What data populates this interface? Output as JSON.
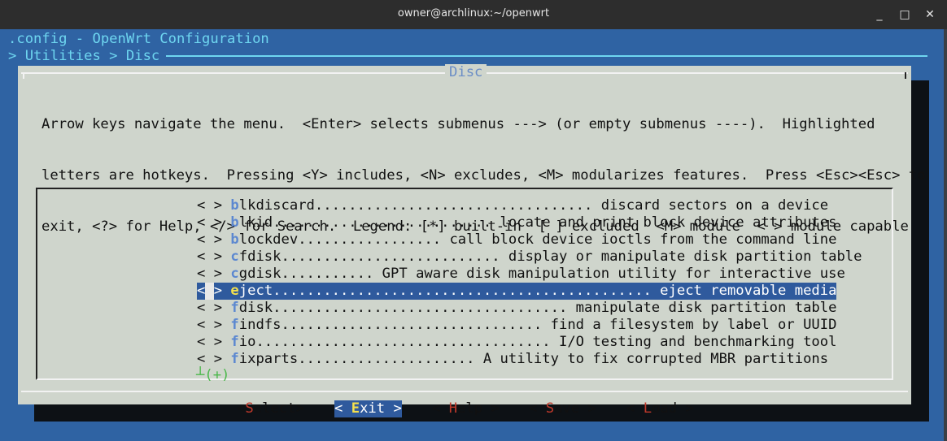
{
  "window": {
    "title": "owner@archlinux:~/openwrt",
    "minimize": "_",
    "maximize": "□",
    "close": "✕"
  },
  "header": {
    "line1": ".config - OpenWrt Configuration",
    "line2": "> Utilities > Disc"
  },
  "dialog": {
    "title": "Disc",
    "help": [
      "Arrow keys navigate the menu.  <Enter> selects submenus ---> (or empty submenus ----).  Highlighted",
      "letters are hotkeys.  Pressing <Y> includes, <N> excludes, <M> modularizes features.  Press <Esc><Esc> to",
      "exit, <?> for Help, </> for Search.  Legend: [*] built-in  [ ] excluded  <M> module  < > module capable"
    ]
  },
  "menu": {
    "items": [
      {
        "prefix": "< > ",
        "hotkey": "b",
        "rest": "lkdiscard................................. discard sectors on a device",
        "selected": false
      },
      {
        "prefix": "< > ",
        "hotkey": "b",
        "rest": "lkid.......................... locate and print block device attributes",
        "selected": false
      },
      {
        "prefix": "< > ",
        "hotkey": "b",
        "rest": "lockdev................. call block device ioctls from the command line",
        "selected": false
      },
      {
        "prefix": "< > ",
        "hotkey": "c",
        "rest": "fdisk.......................... display or manipulate disk partition table",
        "selected": false
      },
      {
        "prefix": "< > ",
        "hotkey": "c",
        "rest": "gdisk........... GPT aware disk manipulation utility for interactive use",
        "selected": false
      },
      {
        "prefix": "<",
        "cursor": " ",
        "prefix2": "> ",
        "hotkey": "e",
        "rest": "ject............................................. eject removable media",
        "selected": true
      },
      {
        "prefix": "< > ",
        "hotkey": "f",
        "rest": "disk................................... manipulate disk partition table",
        "selected": false
      },
      {
        "prefix": "< > ",
        "hotkey": "f",
        "rest": "indfs............................... find a filesystem by label or UUID",
        "selected": false
      },
      {
        "prefix": "< > ",
        "hotkey": "f",
        "rest": "io................................... I/O testing and benchmarking tool",
        "selected": false
      },
      {
        "prefix": "< > ",
        "hotkey": "f",
        "rest": "ixparts..................... A utility to fix corrupted MBR partitions",
        "selected": false
      }
    ],
    "more_indicator": "┴(+)"
  },
  "buttons": [
    {
      "left": "<",
      "hotkey": "S",
      "rest": "elect",
      "right": ">",
      "active": false
    },
    {
      "left": "< ",
      "hotkey": "E",
      "rest": "xit",
      "right": " >",
      "active": true
    },
    {
      "left": "< ",
      "hotkey": "H",
      "rest": "elp",
      "right": " >",
      "active": false
    },
    {
      "left": "< ",
      "hotkey": "S",
      "rest": "ave",
      "right": " >",
      "active": false
    },
    {
      "left": "< ",
      "hotkey": "L",
      "rest": "oad",
      "right": " >",
      "active": false
    }
  ]
}
